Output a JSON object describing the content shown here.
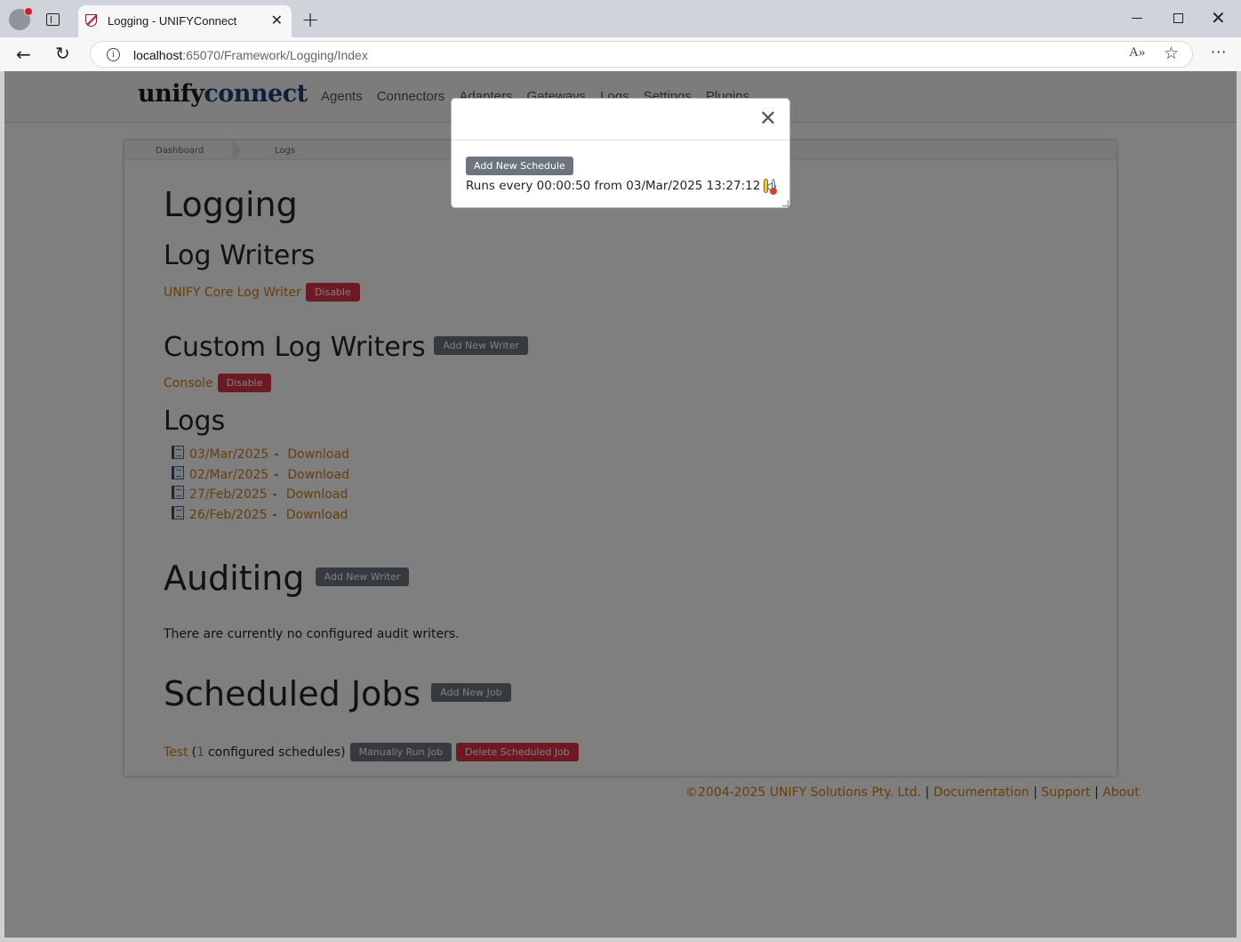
{
  "browser": {
    "tab_title": "Logging - UNIFYConnect",
    "url_host": "localhost",
    "url_path": ":65070/Framework/Logging/Index"
  },
  "nav": {
    "logo_part1": "unify",
    "logo_part2": "connect",
    "items": [
      "Agents",
      "Connectors",
      "Adapters",
      "Gateways",
      "Logs",
      "Settings",
      "Plugins"
    ]
  },
  "breadcrumb": [
    "Dashboard",
    "Logs"
  ],
  "page": {
    "title": "Logging",
    "log_writers": {
      "heading": "Log Writers",
      "writer_name": "UNIFY Core Log Writer",
      "disable_label": "Disable"
    },
    "custom_log_writers": {
      "heading": "Custom Log Writers",
      "add_label": "Add New Writer",
      "writer_name": "Console",
      "disable_label": "Disable"
    },
    "logs": {
      "heading": "Logs",
      "separator": "-",
      "download_label": "Download",
      "dates": [
        "03/Mar/2025",
        "02/Mar/2025",
        "27/Feb/2025",
        "26/Feb/2025"
      ]
    },
    "auditing": {
      "heading": "Auditing",
      "add_label": "Add New Writer",
      "empty_text": "There are currently no configured audit writers."
    },
    "scheduled_jobs": {
      "heading": "Scheduled Jobs",
      "add_label": "Add New Job",
      "job_name": "Test",
      "open_paren": "(",
      "schedule_count": "1",
      "schedule_text": "configured schedules)",
      "run_label": "Manually Run Job",
      "delete_label": "Delete Scheduled Job"
    }
  },
  "footer": {
    "copyright": "©2004-2025 UNIFY Solutions Pty. Ltd.",
    "sep": "|",
    "documentation": "Documentation",
    "support": "Support",
    "about": "About"
  },
  "modal": {
    "add_schedule_label": "Add New Schedule",
    "schedule_text": "Runs every 00:00:50 from 03/Mar/2025 13:27:12"
  }
}
